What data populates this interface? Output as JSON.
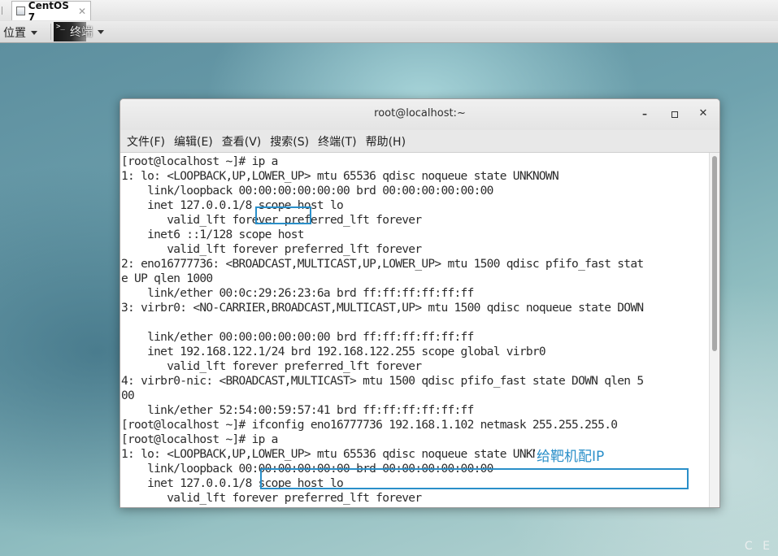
{
  "vm_tab": {
    "label": "CentOS 7",
    "close": "✕"
  },
  "topbar": {
    "places": "位置",
    "terminal_app": "终端",
    "terminal_icon_glyph": ">_"
  },
  "desktop": {
    "corner_mark": "C E"
  },
  "window": {
    "title": "root@localhost:~",
    "controls": {
      "minimize": "–",
      "close": "✕"
    },
    "menu": [
      "文件(F)",
      "编辑(E)",
      "查看(V)",
      "搜索(S)",
      "终端(T)",
      "帮助(H)"
    ]
  },
  "terminal": {
    "lines": [
      "[root@localhost ~]# ip a",
      "1: lo: <LOOPBACK,UP,LOWER_UP> mtu 65536 qdisc noqueue state UNKNOWN",
      "    link/loopback 00:00:00:00:00:00 brd 00:00:00:00:00:00",
      "    inet 127.0.0.1/8 scope host lo",
      "       valid_lft forever preferred_lft forever",
      "    inet6 ::1/128 scope host",
      "       valid_lft forever preferred_lft forever",
      "2: eno16777736: <BROADCAST,MULTICAST,UP,LOWER_UP> mtu 1500 qdisc pfifo_fast stat",
      "e UP qlen 1000",
      "    link/ether 00:0c:29:26:23:6a brd ff:ff:ff:ff:ff:ff",
      "3: virbr0: <NO-CARRIER,BROADCAST,MULTICAST,UP> mtu 1500 qdisc noqueue state DOWN",
      "",
      "    link/ether 00:00:00:00:00:00 brd ff:ff:ff:ff:ff:ff",
      "    inet 192.168.122.1/24 brd 192.168.122.255 scope global virbr0",
      "       valid_lft forever preferred_lft forever",
      "4: virbr0-nic: <BROADCAST,MULTICAST> mtu 1500 qdisc pfifo_fast state DOWN qlen 5",
      "00",
      "    link/ether 52:54:00:59:57:41 brd ff:ff:ff:ff:ff:ff",
      "[root@localhost ~]# ifconfig eno16777736 192.168.1.102 netmask 255.255.255.0",
      "[root@localhost ~]# ip a",
      "1: lo: <LOOPBACK,UP,LOWER_UP> mtu 65536 qdisc noqueue state UNKNOWN",
      "    link/loopback 00:00:00:00:00:00 brd 00:00:00:00:00:00",
      "    inet 127.0.0.1/8 scope host lo",
      "       valid_lft forever preferred_lft forever"
    ]
  },
  "annotation": {
    "text": "给靶机配IP",
    "color": "#2a8fc9"
  }
}
